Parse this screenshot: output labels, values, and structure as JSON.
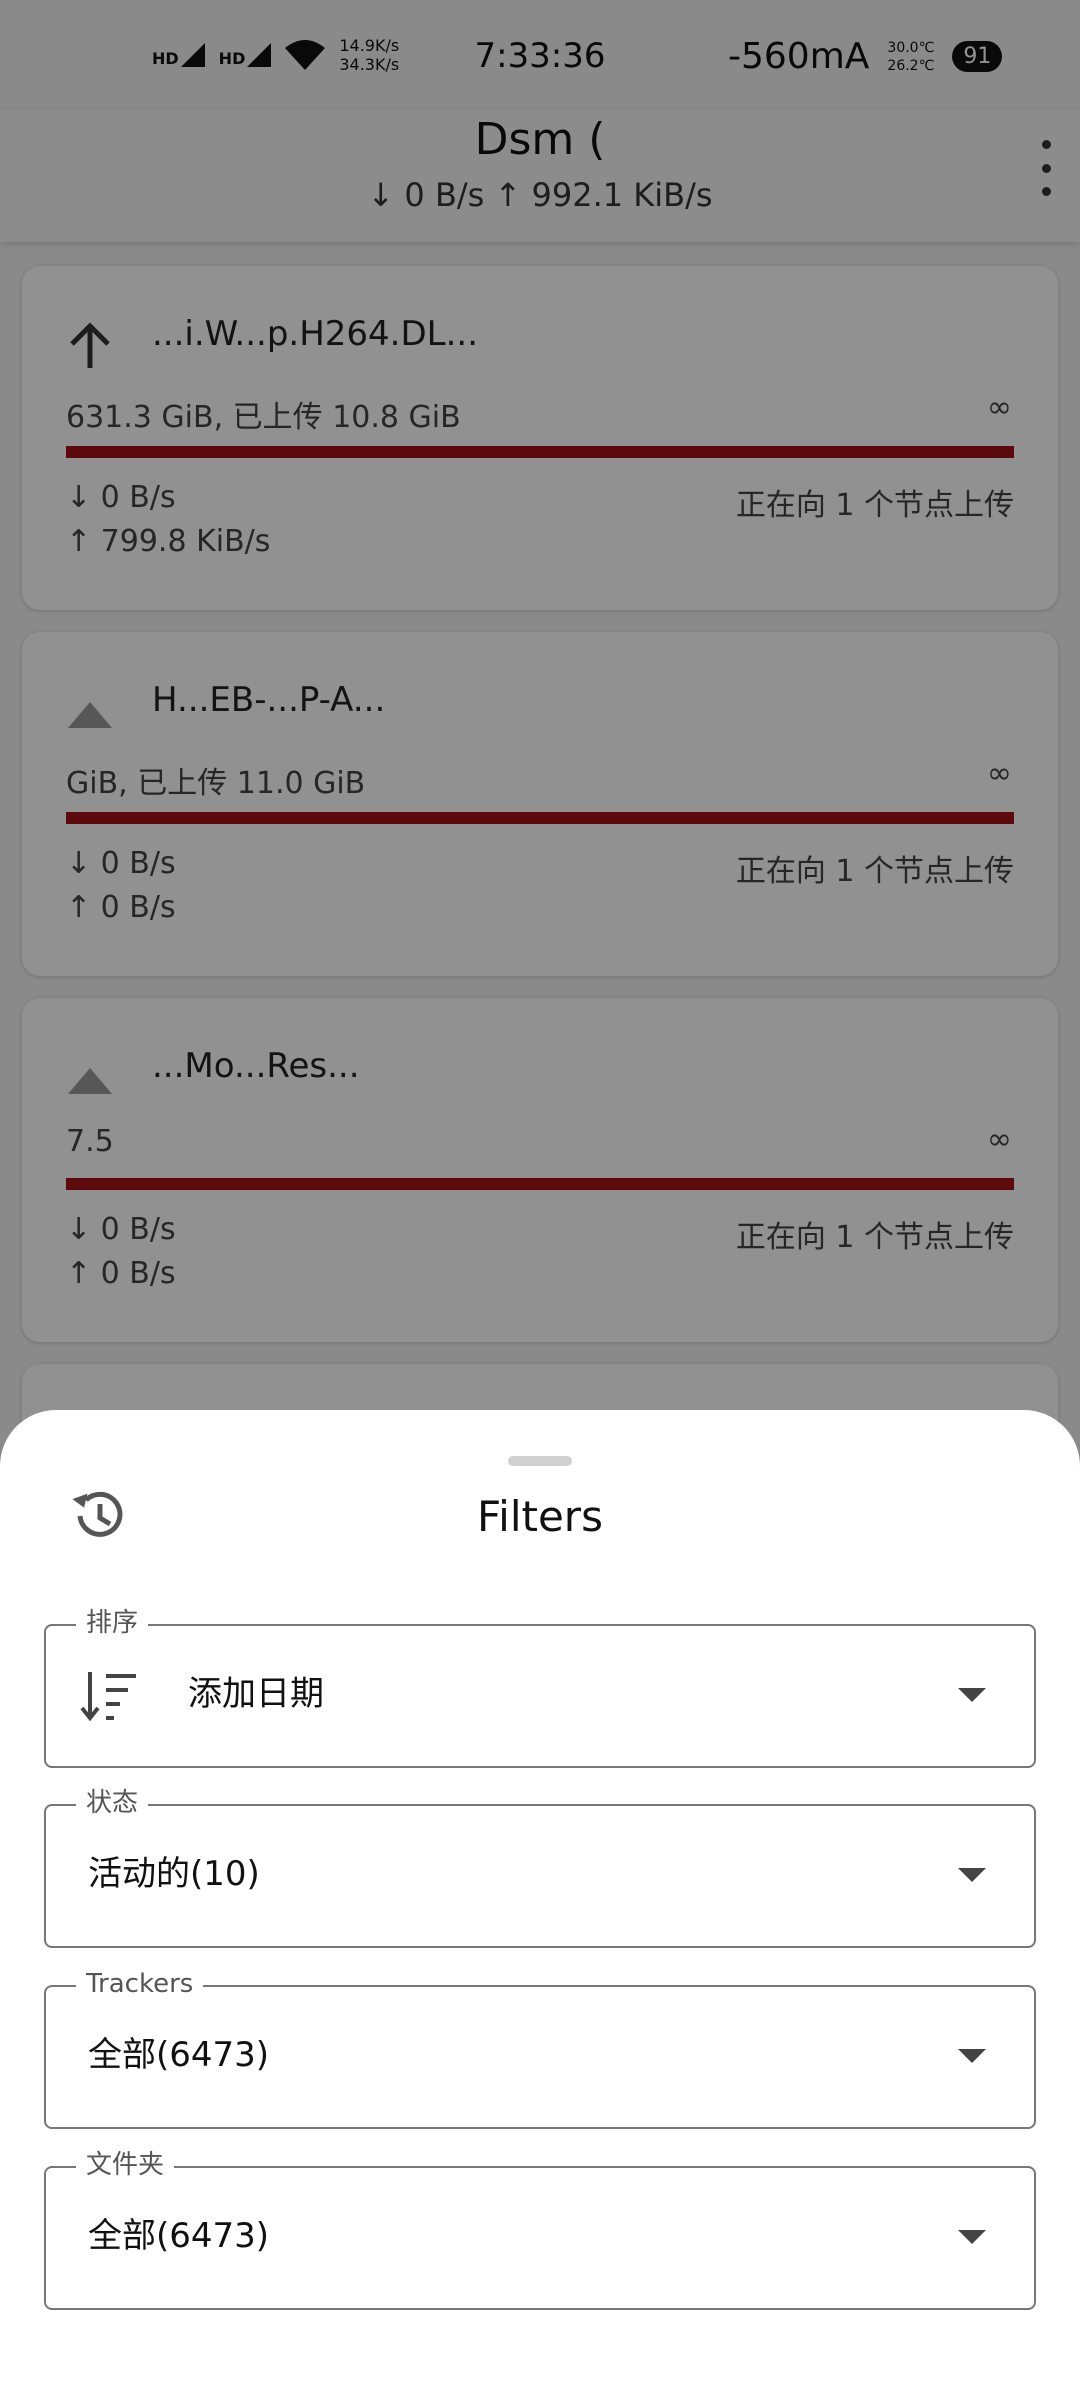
{
  "status_bar": {
    "hd1": "HD",
    "hd2": "HD",
    "net_up": "14.9K/s",
    "net_down": "34.3K/s",
    "time": "7:33:36",
    "current": "-560mA",
    "temp1": "30.0℃",
    "temp2": "26.2℃",
    "battery": "91"
  },
  "app_bar": {
    "title": "Dsm (",
    "subtitle": "↓ 0 B/s ↑ 992.1 KiB/s"
  },
  "torrents": [
    {
      "name": "...i.W...p.H264.DL...",
      "size_text": "631.3 GiB, 已上传 10.8 GiB",
      "ratio": "∞",
      "progress": 1.0,
      "dl_speed": "↓ 0 B/s",
      "ul_speed": "↑ 799.8 KiB/s",
      "status": "正在向 1 个节点上传",
      "icon": "upload-arrow-icon"
    },
    {
      "name": "H...EB-...P-A...",
      "size_text": "GiB, 已上传 11.0 GiB",
      "ratio": "∞",
      "progress": 1.0,
      "dl_speed": "↓ 0 B/s",
      "ul_speed": "↑ 0 B/s",
      "status": "正在向 1 个节点上传",
      "icon": "upload-icon"
    },
    {
      "name": "...Mo...Res...",
      "size_text": "7.5",
      "ratio": "∞",
      "progress": 1.0,
      "dl_speed": "↓ 0 B/s",
      "ul_speed": "↑ 0 B/s",
      "status": "正在向 1 个节点上传",
      "icon": "upload-icon"
    }
  ],
  "sheet": {
    "title": "Filters",
    "sort": {
      "label": "排序",
      "value": "添加日期"
    },
    "state": {
      "label": "状态",
      "value": "活动的(10)"
    },
    "trackers": {
      "label": "Trackers",
      "value": "全部(6473)"
    },
    "folder": {
      "label": "文件夹",
      "value": "全部(6473)"
    }
  },
  "colors": {
    "progress": "#a4121a",
    "scrim": "rgba(0,0,0,0.43)",
    "sheet_bg": "#ffffff"
  }
}
